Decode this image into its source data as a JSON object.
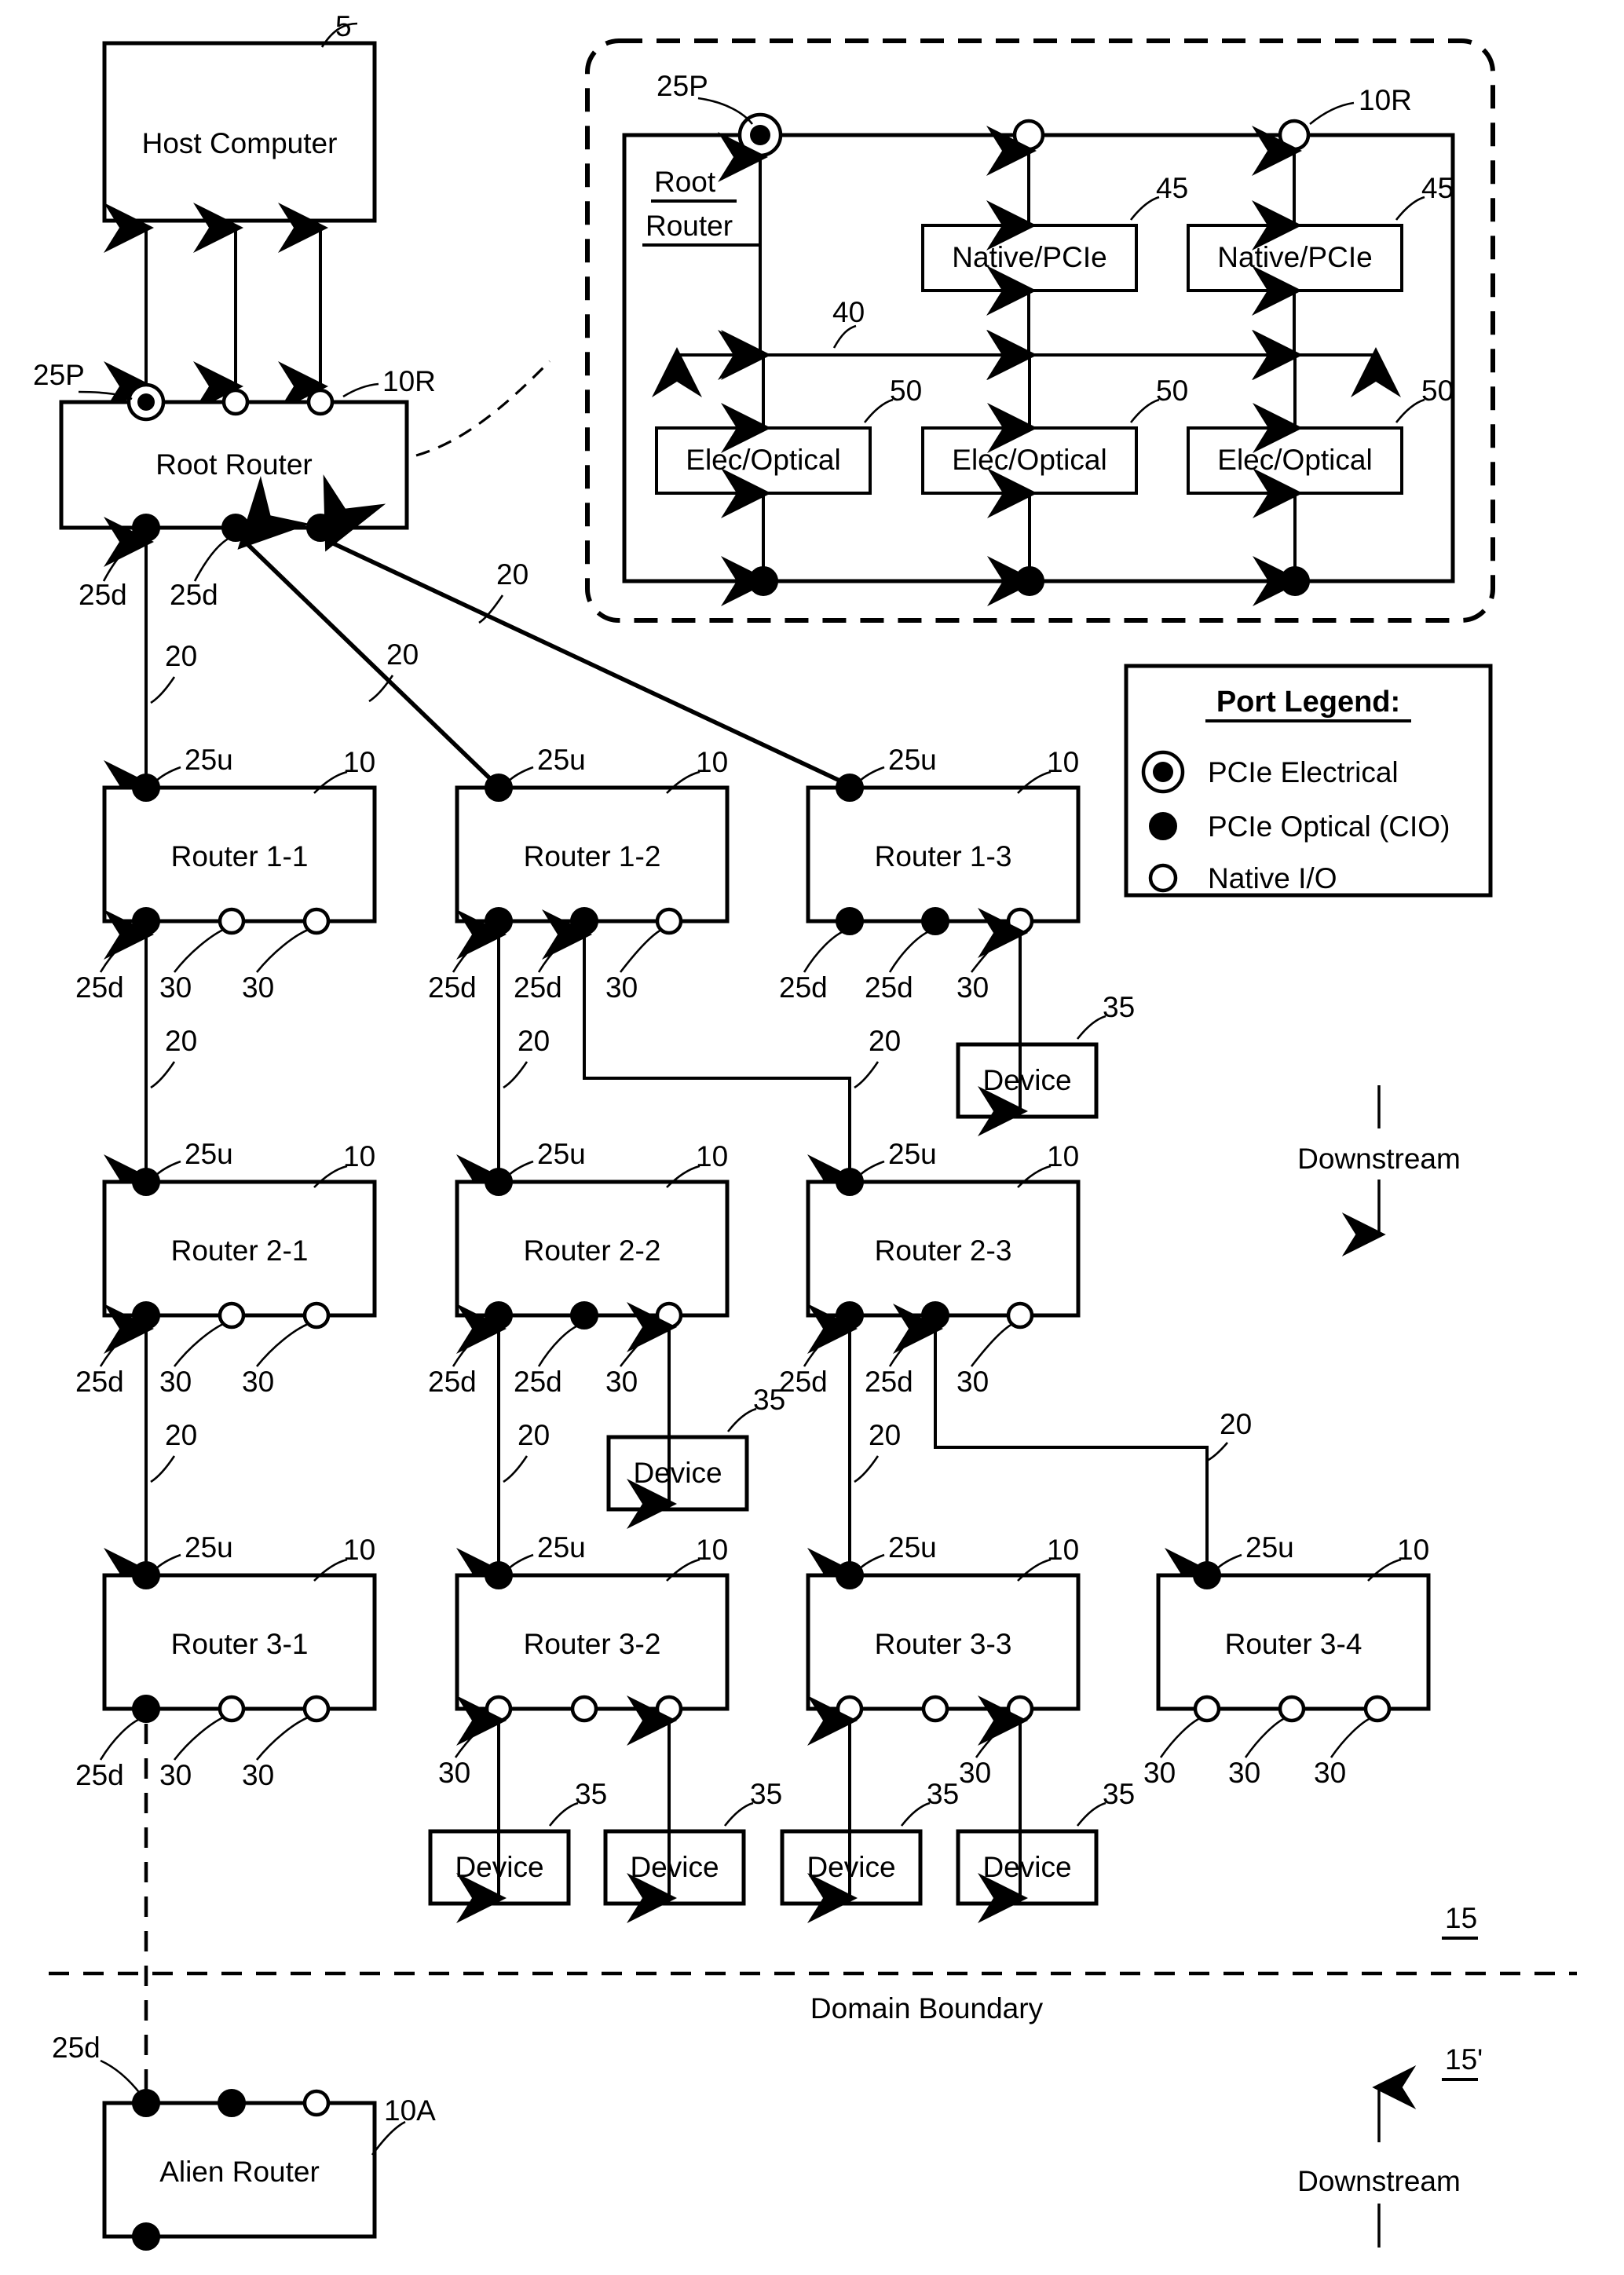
{
  "figure": {
    "host": {
      "label": "Host Computer",
      "ref": "5"
    },
    "root_router": {
      "label": "Root Router",
      "ref": "10R",
      "pcie_electrical_port_ref": "25P",
      "downstream_port_ref": "25d"
    },
    "inset": {
      "title_line1": "Root",
      "title_line2": "Router",
      "router_ref": "10R",
      "pcie_port_ref": "25P",
      "bus_ref": "40",
      "native_pcie_label": "Native/PCIe",
      "native_pcie_ref": "45",
      "elec_optical_label": "Elec/Optical",
      "elec_optical_ref": "50"
    },
    "legend": {
      "title": "Port Legend:",
      "items": [
        {
          "icon": "pcie-electrical-port-icon",
          "label": "PCIe Electrical"
        },
        {
          "icon": "pcie-optical-port-icon",
          "label": "PCIe Optical (CIO)"
        },
        {
          "icon": "native-io-port-icon",
          "label": "Native I/O"
        }
      ]
    },
    "routers": [
      {
        "name": "Router 1-1",
        "ref": "10",
        "upstream_ref": "25u",
        "down_labels": [
          "25d",
          "30",
          "30"
        ],
        "down_types": [
          "optical",
          "native",
          "native"
        ]
      },
      {
        "name": "Router 1-2",
        "ref": "10",
        "upstream_ref": "25u",
        "down_labels": [
          "25d",
          "25d",
          "30"
        ],
        "down_types": [
          "optical",
          "optical",
          "native"
        ]
      },
      {
        "name": "Router 1-3",
        "ref": "10",
        "upstream_ref": "25u",
        "down_labels": [
          "25d",
          "25d",
          "30"
        ],
        "down_types": [
          "optical",
          "optical",
          "native"
        ]
      },
      {
        "name": "Router 2-1",
        "ref": "10",
        "upstream_ref": "25u",
        "down_labels": [
          "25d",
          "30",
          "30"
        ],
        "down_types": [
          "optical",
          "native",
          "native"
        ]
      },
      {
        "name": "Router 2-2",
        "ref": "10",
        "upstream_ref": "25u",
        "down_labels": [
          "25d",
          "25d",
          "30"
        ],
        "down_types": [
          "optical",
          "optical",
          "native"
        ]
      },
      {
        "name": "Router 2-3",
        "ref": "10",
        "upstream_ref": "25u",
        "down_labels": [
          "25d",
          "25d",
          "30"
        ],
        "down_types": [
          "optical",
          "optical",
          "native"
        ]
      },
      {
        "name": "Router 3-1",
        "ref": "10",
        "upstream_ref": "25u",
        "down_labels": [
          "25d",
          "30",
          "30"
        ],
        "down_types": [
          "optical",
          "native",
          "native"
        ]
      },
      {
        "name": "Router 3-2",
        "ref": "10",
        "upstream_ref": "25u",
        "down_labels": [
          "30",
          "",
          "35"
        ],
        "down_types": [
          "native",
          "native",
          "native"
        ]
      },
      {
        "name": "Router 3-3",
        "ref": "10",
        "upstream_ref": "25u",
        "down_labels": [
          "",
          "30",
          ""
        ],
        "down_types": [
          "native",
          "native",
          "native"
        ]
      },
      {
        "name": "Router 3-4",
        "ref": "10",
        "upstream_ref": "25u",
        "down_labels": [
          "30",
          "30",
          "30"
        ],
        "down_types": [
          "native",
          "native",
          "native"
        ]
      }
    ],
    "alien_router": {
      "label": "Alien Router",
      "ref": "10A",
      "port_ref": "25d"
    },
    "device_label": "Device",
    "device_ref": "35",
    "link_ref": "20",
    "domain_boundary_label": "Domain Boundary",
    "domain_upper_ref": "15",
    "domain_lower_ref": "15'",
    "downstream_label": "Downstream"
  }
}
